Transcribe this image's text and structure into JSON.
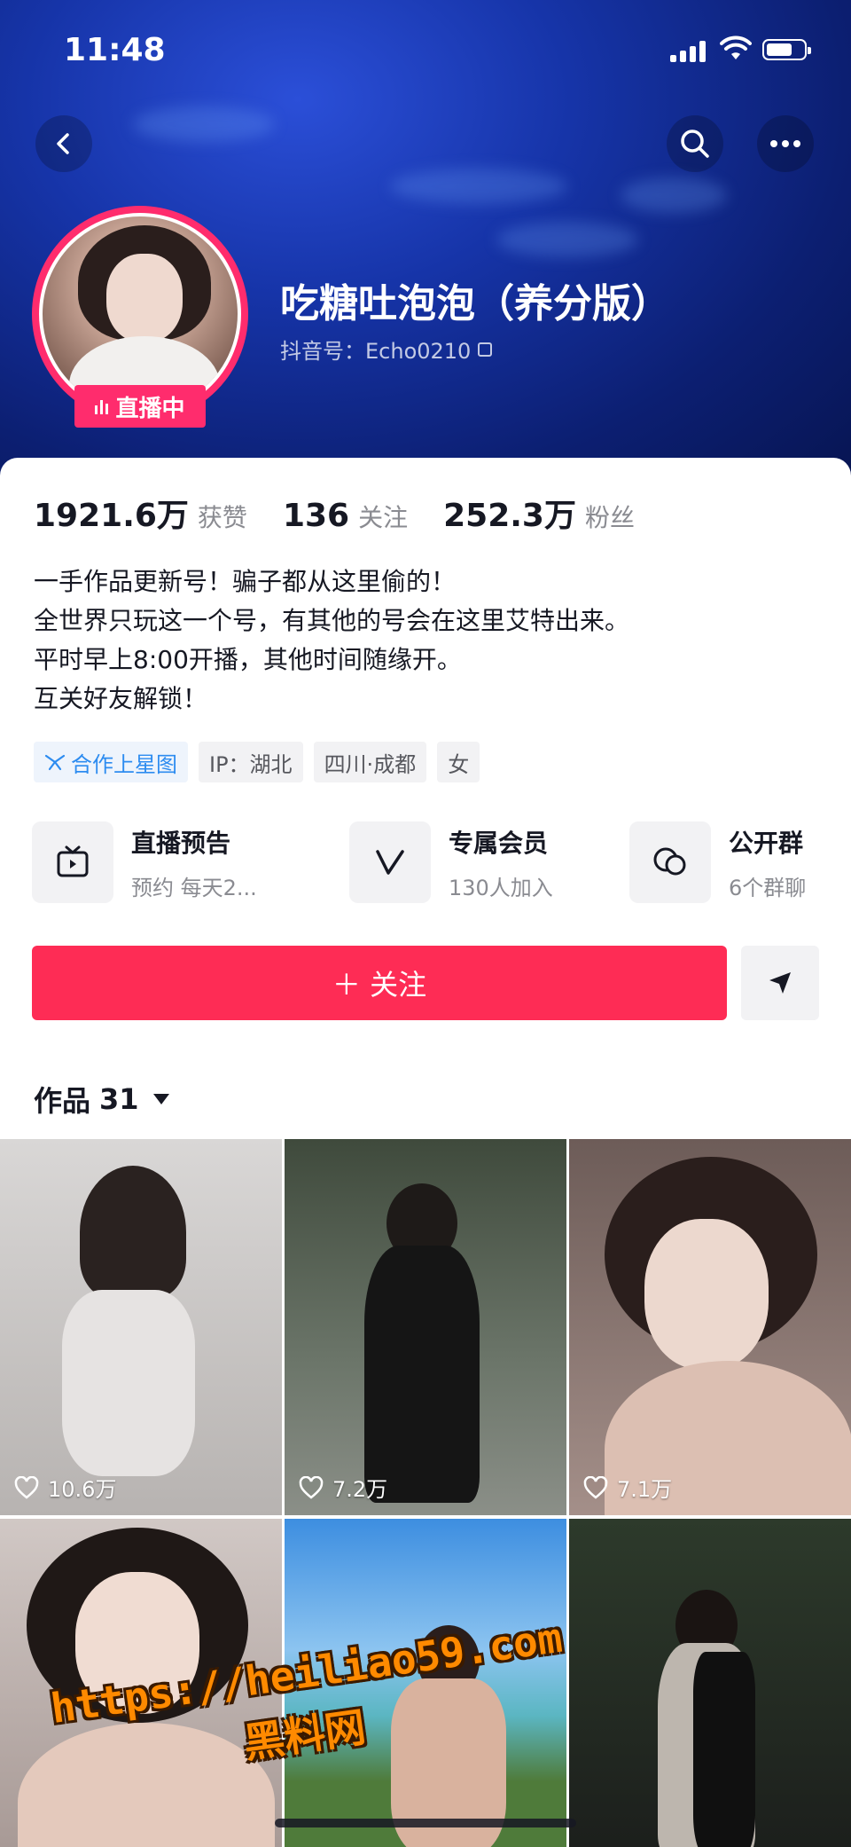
{
  "status_bar": {
    "time": "11:48"
  },
  "profile": {
    "nickname": "吃糖吐泡泡（养分版）",
    "douyin_id": "抖音号：Echo0210",
    "live_badge": "直播中"
  },
  "stats": [
    {
      "value": "1921.6万",
      "label": "获赞"
    },
    {
      "value": "136",
      "label": "关注"
    },
    {
      "value": "252.3万",
      "label": "粉丝"
    }
  ],
  "bio": [
    "一手作品更新号！骗子都从这里偷的！",
    "全世界只玩这一个号，有其他的号会在这里艾特出来。",
    "平时早上8:00开播，其他时间随缘开。",
    "互关好友解锁！"
  ],
  "tags": [
    {
      "label": "合作上星图",
      "icon": "star-chart-icon"
    },
    {
      "label": "IP：湖北"
    },
    {
      "label": "四川·成都"
    },
    {
      "label": "女"
    }
  ],
  "cards": [
    {
      "title": "直播预告",
      "subtitle": "预约 每天2...",
      "icon": "tv-icon"
    },
    {
      "title": "专属会员",
      "subtitle": "130人加入",
      "icon": "v-member-icon"
    },
    {
      "title": "公开群",
      "subtitle": "6个群聊",
      "icon": "chat-bubbles-icon"
    }
  ],
  "actions": {
    "follow_label": "＋ 关注",
    "share_icon": "send-icon"
  },
  "works": {
    "label": "作品",
    "count": "31"
  },
  "videos": [
    {
      "likes": "10.6万",
      "bg": "#c9c6c4"
    },
    {
      "likes": "7.2万",
      "bg": "#5b6a58"
    },
    {
      "likes": "7.1万",
      "bg": "#9b8a86"
    },
    {
      "likes": "",
      "bg": "#bdb3b0"
    },
    {
      "likes": "",
      "bg": "#5fa6e6"
    },
    {
      "likes": "",
      "bg": "#2b2f2c"
    }
  ],
  "watermark": {
    "url": "https://heiliao59.com",
    "name": "黑料网"
  },
  "colors": {
    "accent": "#fe2c55",
    "live": "#ff2c6d",
    "header": "#1634a8"
  }
}
